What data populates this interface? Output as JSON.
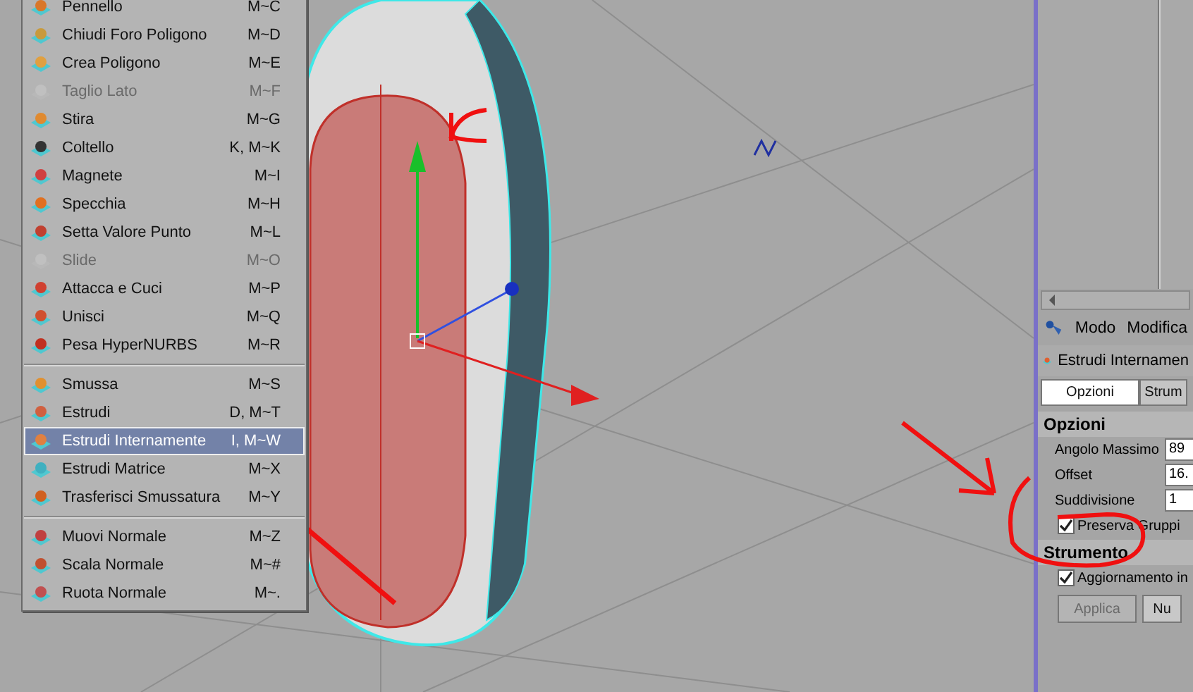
{
  "context_menu": {
    "groups": [
      [
        {
          "label": "Pennello",
          "shortcut": "M~C",
          "disabled": false,
          "selected": false
        },
        {
          "label": "Chiudi Foro Poligono",
          "shortcut": "M~D",
          "disabled": false,
          "selected": false
        },
        {
          "label": "Crea Poligono",
          "shortcut": "M~E",
          "disabled": false,
          "selected": false
        },
        {
          "label": "Taglio Lato",
          "shortcut": "M~F",
          "disabled": true,
          "selected": false
        },
        {
          "label": "Stira",
          "shortcut": "M~G",
          "disabled": false,
          "selected": false
        },
        {
          "label": "Coltello",
          "shortcut": "K, M~K",
          "disabled": false,
          "selected": false
        },
        {
          "label": "Magnete",
          "shortcut": "M~I",
          "disabled": false,
          "selected": false
        },
        {
          "label": "Specchia",
          "shortcut": "M~H",
          "disabled": false,
          "selected": false
        },
        {
          "label": "Setta Valore Punto",
          "shortcut": "M~L",
          "disabled": false,
          "selected": false
        },
        {
          "label": "Slide",
          "shortcut": "M~O",
          "disabled": true,
          "selected": false
        },
        {
          "label": "Attacca e Cuci",
          "shortcut": "M~P",
          "disabled": false,
          "selected": false
        },
        {
          "label": "Unisci",
          "shortcut": "M~Q",
          "disabled": false,
          "selected": false
        },
        {
          "label": "Pesa HyperNURBS",
          "shortcut": "M~R",
          "disabled": false,
          "selected": false
        }
      ],
      [
        {
          "label": "Smussa",
          "shortcut": "M~S",
          "disabled": false,
          "selected": false
        },
        {
          "label": "Estrudi",
          "shortcut": "D, M~T",
          "disabled": false,
          "selected": false
        },
        {
          "label": "Estrudi Internamente",
          "shortcut": "I, M~W",
          "disabled": false,
          "selected": true
        },
        {
          "label": "Estrudi Matrice",
          "shortcut": "M~X",
          "disabled": false,
          "selected": false
        },
        {
          "label": "Trasferisci Smussatura",
          "shortcut": "M~Y",
          "disabled": false,
          "selected": false
        }
      ],
      [
        {
          "label": "Muovi Normale",
          "shortcut": "M~Z",
          "disabled": false,
          "selected": false
        },
        {
          "label": "Scala Normale",
          "shortcut": "M~#",
          "disabled": false,
          "selected": false
        },
        {
          "label": "Ruota Normale",
          "shortcut": "M~.",
          "disabled": false,
          "selected": false
        }
      ]
    ]
  },
  "attribute_panel": {
    "menu": [
      "Modo",
      "Modifica"
    ],
    "title": "Estrudi Internamen",
    "tabs": [
      {
        "label": "Opzioni",
        "selected": true
      },
      {
        "label": "Strum",
        "selected": false
      }
    ],
    "sections": [
      {
        "title": "Opzioni",
        "fields": [
          {
            "kind": "number",
            "label": "Angolo Massimo",
            "value": "89"
          },
          {
            "kind": "number",
            "label": "Offset",
            "value": "16."
          },
          {
            "kind": "number",
            "label": "Suddivisione",
            "value": "1"
          },
          {
            "kind": "checkbox",
            "label": "Preserva Gruppi",
            "checked": true
          }
        ]
      },
      {
        "title": "Strumento",
        "fields": [
          {
            "kind": "checkbox",
            "label": "Aggiornamento in",
            "checked": true
          }
        ]
      }
    ],
    "buttons": [
      {
        "label": "Applica",
        "disabled": true
      },
      {
        "label": "Nu",
        "disabled": false
      }
    ]
  }
}
